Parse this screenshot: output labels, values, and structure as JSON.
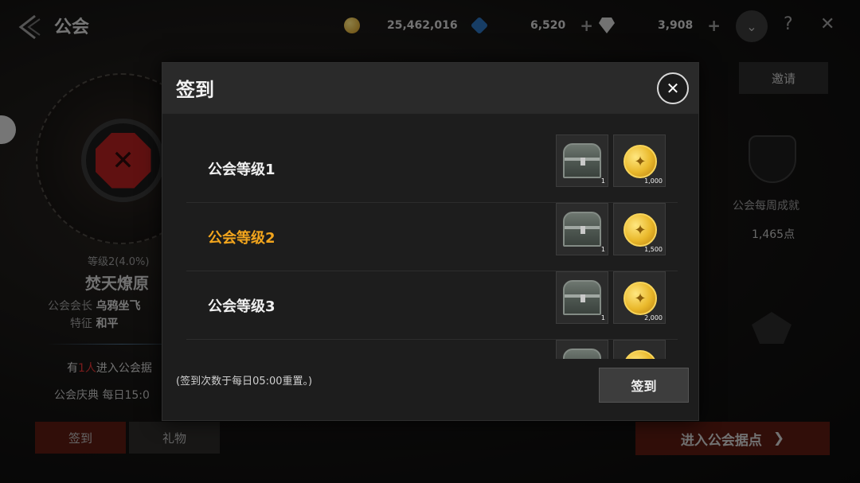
{
  "background": {
    "page_title": "公会",
    "currencies": [
      {
        "icon": "gold-coin-icon",
        "value": "25,462,016"
      },
      {
        "icon": "blue-gem-icon",
        "value": "6,520"
      },
      {
        "icon": "diamond-icon",
        "value": "3,908"
      }
    ],
    "plus_label": "+",
    "help_label": "?",
    "close_label": "✕",
    "guild": {
      "level_text": "等级2(4.0%)",
      "name": "焚天燎原",
      "leader_label": "公会会长",
      "leader_name": "乌鸦坐飞",
      "status_label": "特征",
      "status_value": "和平",
      "notice_prefix": "有",
      "notice_count": "1人",
      "notice_suffix": "进入公会据",
      "event_text": "公会庆典 每日15:0"
    },
    "buttons": {
      "signin": "签到",
      "gift": "礼物",
      "invite": "邀请",
      "enter_base": "进入公会据点"
    },
    "weekly": {
      "label": "公会每周成就",
      "points": "1,465点"
    }
  },
  "modal": {
    "title": "签到",
    "close_icon": "close-icon",
    "rows": [
      {
        "label": "公会等级1",
        "active": false,
        "chest_qty": "1",
        "coin_qty": "1,000"
      },
      {
        "label": "公会等级2",
        "active": true,
        "chest_qty": "1",
        "coin_qty": "1,500"
      },
      {
        "label": "公会等级3",
        "active": false,
        "chest_qty": "1",
        "coin_qty": "2,000"
      },
      {
        "label": "",
        "active": false,
        "chest_qty": "",
        "coin_qty": ""
      }
    ],
    "note": "(签到次数于每日05:00重置。)",
    "sign_button": "签到"
  },
  "colors": {
    "accent_orange": "#f2a51d",
    "panel": "#1d1d1d",
    "header": "#2a2a2a",
    "notice_red": "#dd3333"
  }
}
